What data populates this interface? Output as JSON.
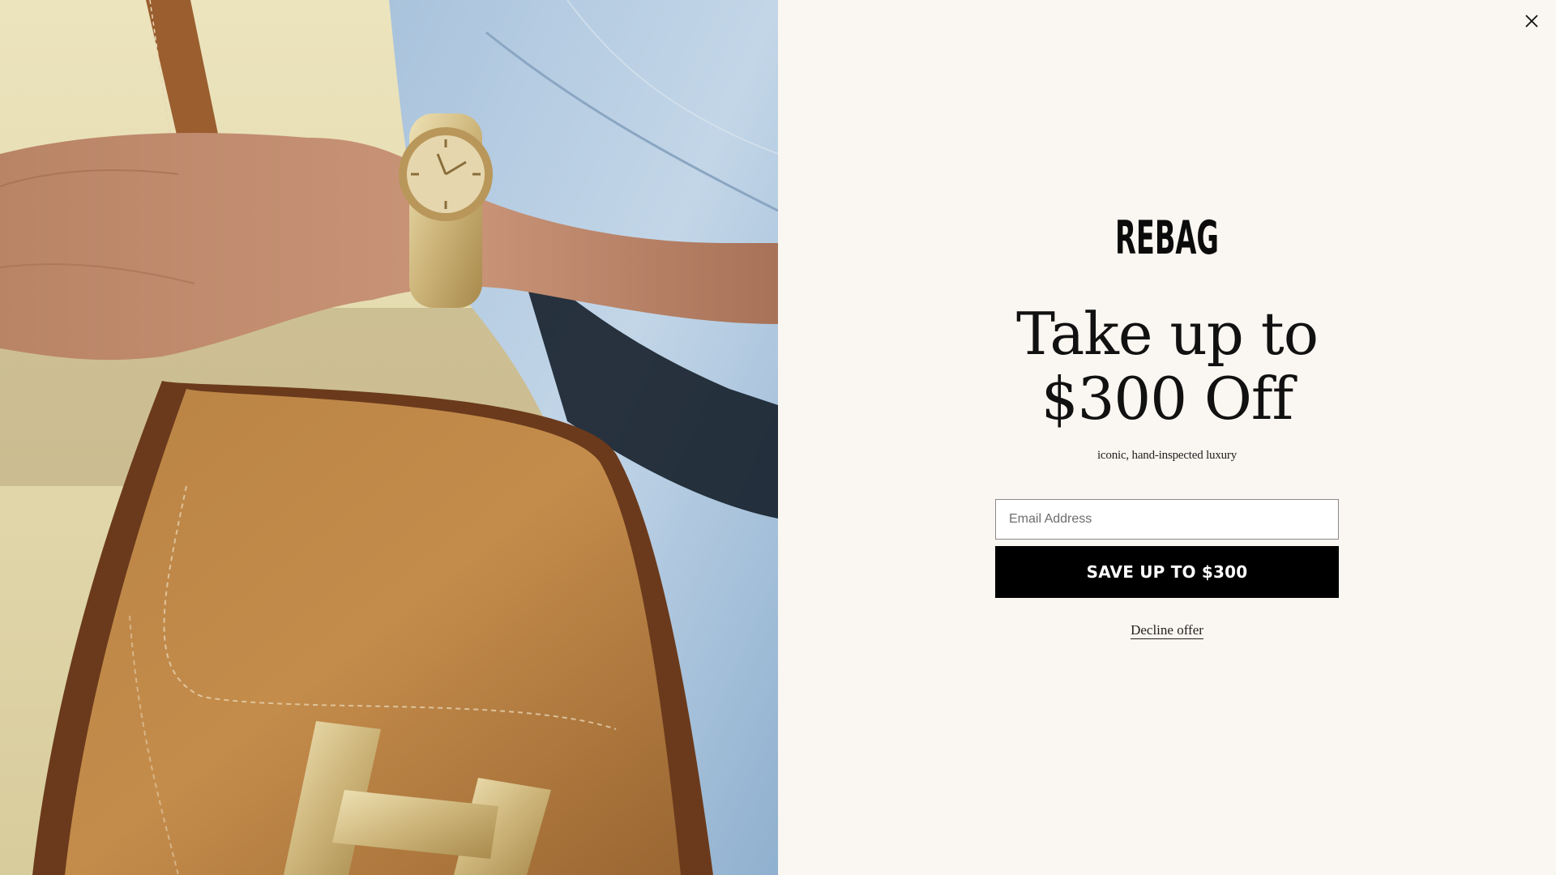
{
  "hero_image": {
    "subject": "wrist with gold watch over tan leather handbag with gold H clasp"
  },
  "offer": {
    "close_icon": "close-icon",
    "brand": "REBAG",
    "headline_line1": "Take up to",
    "headline_line2": "$300 Off",
    "subtitle": "iconic, hand-inspected luxury",
    "email_placeholder": "Email Address",
    "email_value": "",
    "submit_label": "SAVE UP TO $300",
    "decline_label": "Decline offer"
  },
  "colors": {
    "background": "#faf6f1",
    "button": "#000000",
    "button_text": "#ffffff",
    "text": "#111111"
  }
}
